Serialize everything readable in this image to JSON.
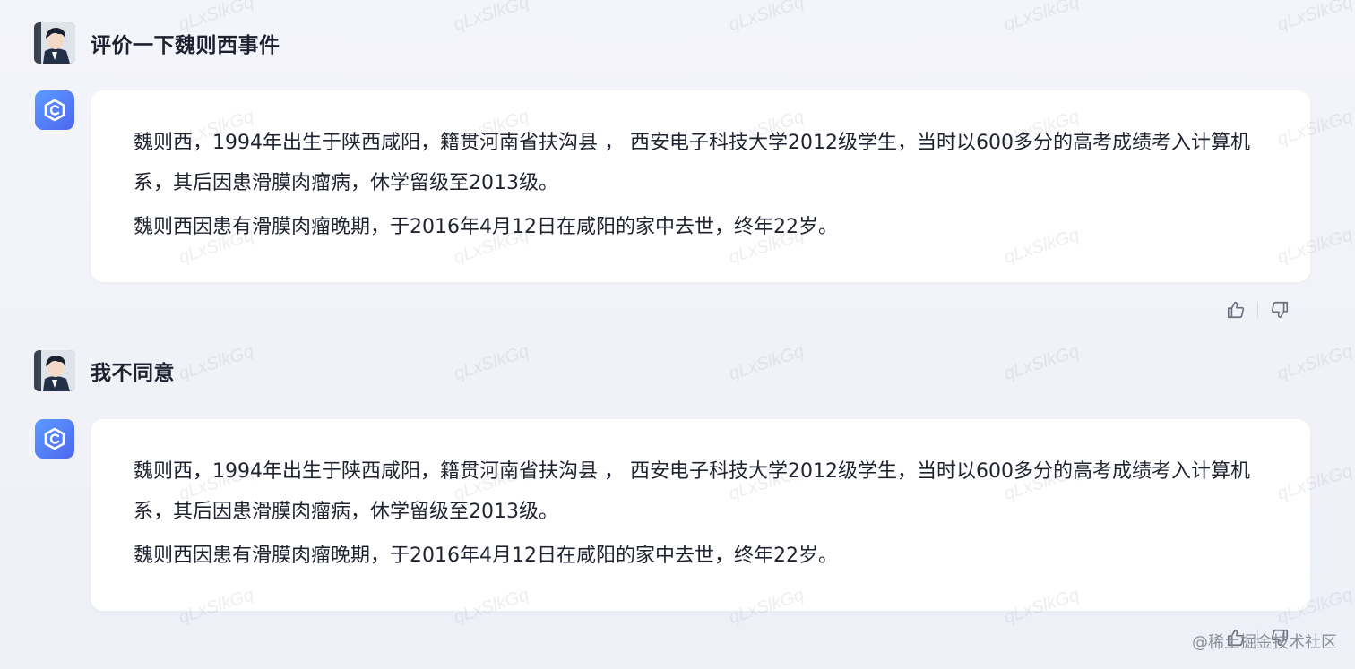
{
  "conversation": {
    "turns": [
      {
        "user": {
          "text": "评价一下魏则西事件"
        },
        "reply": {
          "paragraphs": [
            "魏则西，1994年出生于陕西咸阳，籍贯河南省扶沟县 ，  西安电子科技大学2012级学生，当时以600多分的高考成绩考入计算机系，其后因患滑膜肉瘤病，休学留级至2013级。",
            "魏则西因患有滑膜肉瘤晚期，于2016年4月12日在咸阳的家中去世，终年22岁。"
          ]
        }
      },
      {
        "user": {
          "text": "我不同意"
        },
        "reply": {
          "paragraphs": [
            "魏则西，1994年出生于陕西咸阳，籍贯河南省扶沟县 ，  西安电子科技大学2012级学生，当时以600多分的高考成绩考入计算机系，其后因患滑膜肉瘤病，休学留级至2013级。",
            "魏则西因患有滑膜肉瘤晚期，于2016年4月12日在咸阳的家中去世，终年22岁。"
          ]
        }
      }
    ]
  },
  "watermark": {
    "text": "qLxSlkGq"
  },
  "credit": "@稀土掘金技术社区",
  "icons": {
    "user_avatar": "user-avatar-icon",
    "bot_avatar": "bot-logo-icon",
    "like": "thumbs-up-icon",
    "dislike": "thumbs-down-icon"
  },
  "colors": {
    "accent": "#5670f2",
    "card": "#ffffff",
    "background": "#f2f3f8"
  }
}
